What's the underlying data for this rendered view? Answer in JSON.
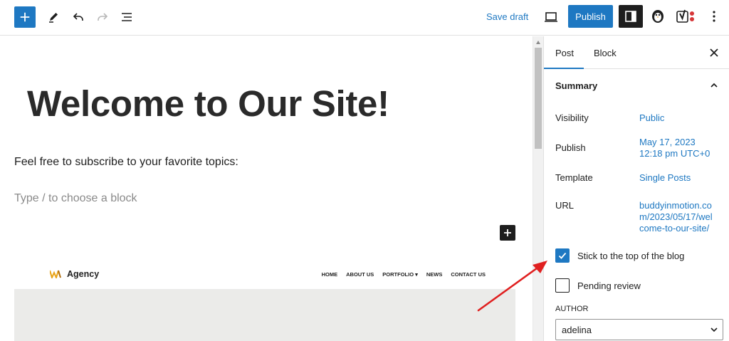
{
  "toolbar": {
    "save_draft_label": "Save draft",
    "publish_label": "Publish"
  },
  "editor": {
    "title": "Welcome to Our Site!",
    "paragraph": "Feel free to subscribe to your favorite topics:",
    "placeholder": "Type / to choose a block"
  },
  "preview_image": {
    "brand": "Agency",
    "nav": [
      "HOME",
      "ABOUT US",
      "PORTFOLIO ▾",
      "NEWS",
      "CONTACT US"
    ]
  },
  "sidebar": {
    "tabs": [
      "Post",
      "Block"
    ],
    "active_tab": "Post",
    "summary_heading": "Summary",
    "rows": [
      {
        "label": "Visibility",
        "value": "Public"
      },
      {
        "label": "Publish",
        "value": "May 17, 2023 12:18 pm UTC+0"
      },
      {
        "label": "Template",
        "value": "Single Posts"
      },
      {
        "label": "URL",
        "value": "buddyinmotion.com/2023/05/17/welcome-to-our-site/"
      }
    ],
    "stick_to_top": {
      "label": "Stick to the top of the blog",
      "checked": true
    },
    "pending_review": {
      "label": "Pending review",
      "checked": false
    },
    "author_label": "AUTHOR",
    "author_value": "adelina"
  },
  "colors": {
    "accent": "#1e78c2",
    "annotation": "#e02020"
  }
}
